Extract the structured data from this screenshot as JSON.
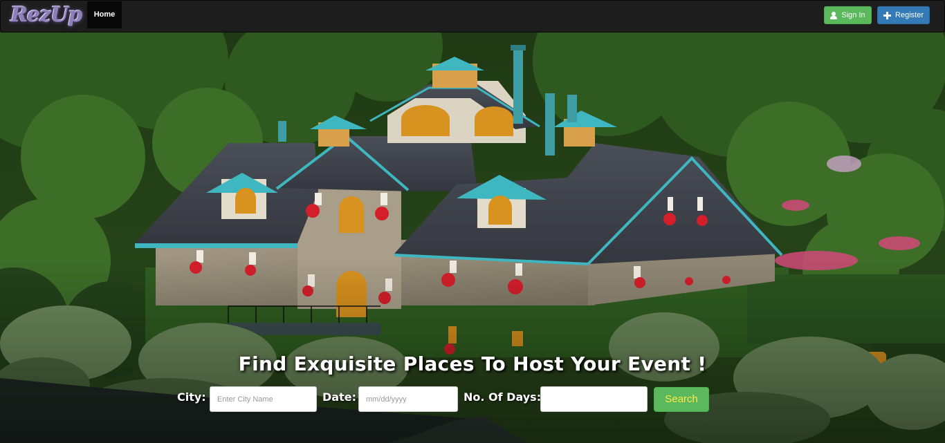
{
  "nav": {
    "brand": "RezUp",
    "home": "Home",
    "sign_in": "Sign In",
    "register": "Register"
  },
  "hero": {
    "headline": "Find Exquisite Places To Host Your Event !",
    "search_form": {
      "city_label": "City:",
      "city_placeholder": "Enter City Name",
      "date_label": "Date:",
      "date_placeholder": "mm/dd/yyyy",
      "days_label": "No. Of Days:",
      "days_value": "",
      "search_button": "Search"
    }
  },
  "colors": {
    "navbar_bg": "#1d1d1d",
    "signin_green": "#5cb85c",
    "register_blue": "#337ab7",
    "search_text": "#ffe94a"
  },
  "icons": {
    "signin": "user-icon",
    "register": "plus-icon"
  }
}
